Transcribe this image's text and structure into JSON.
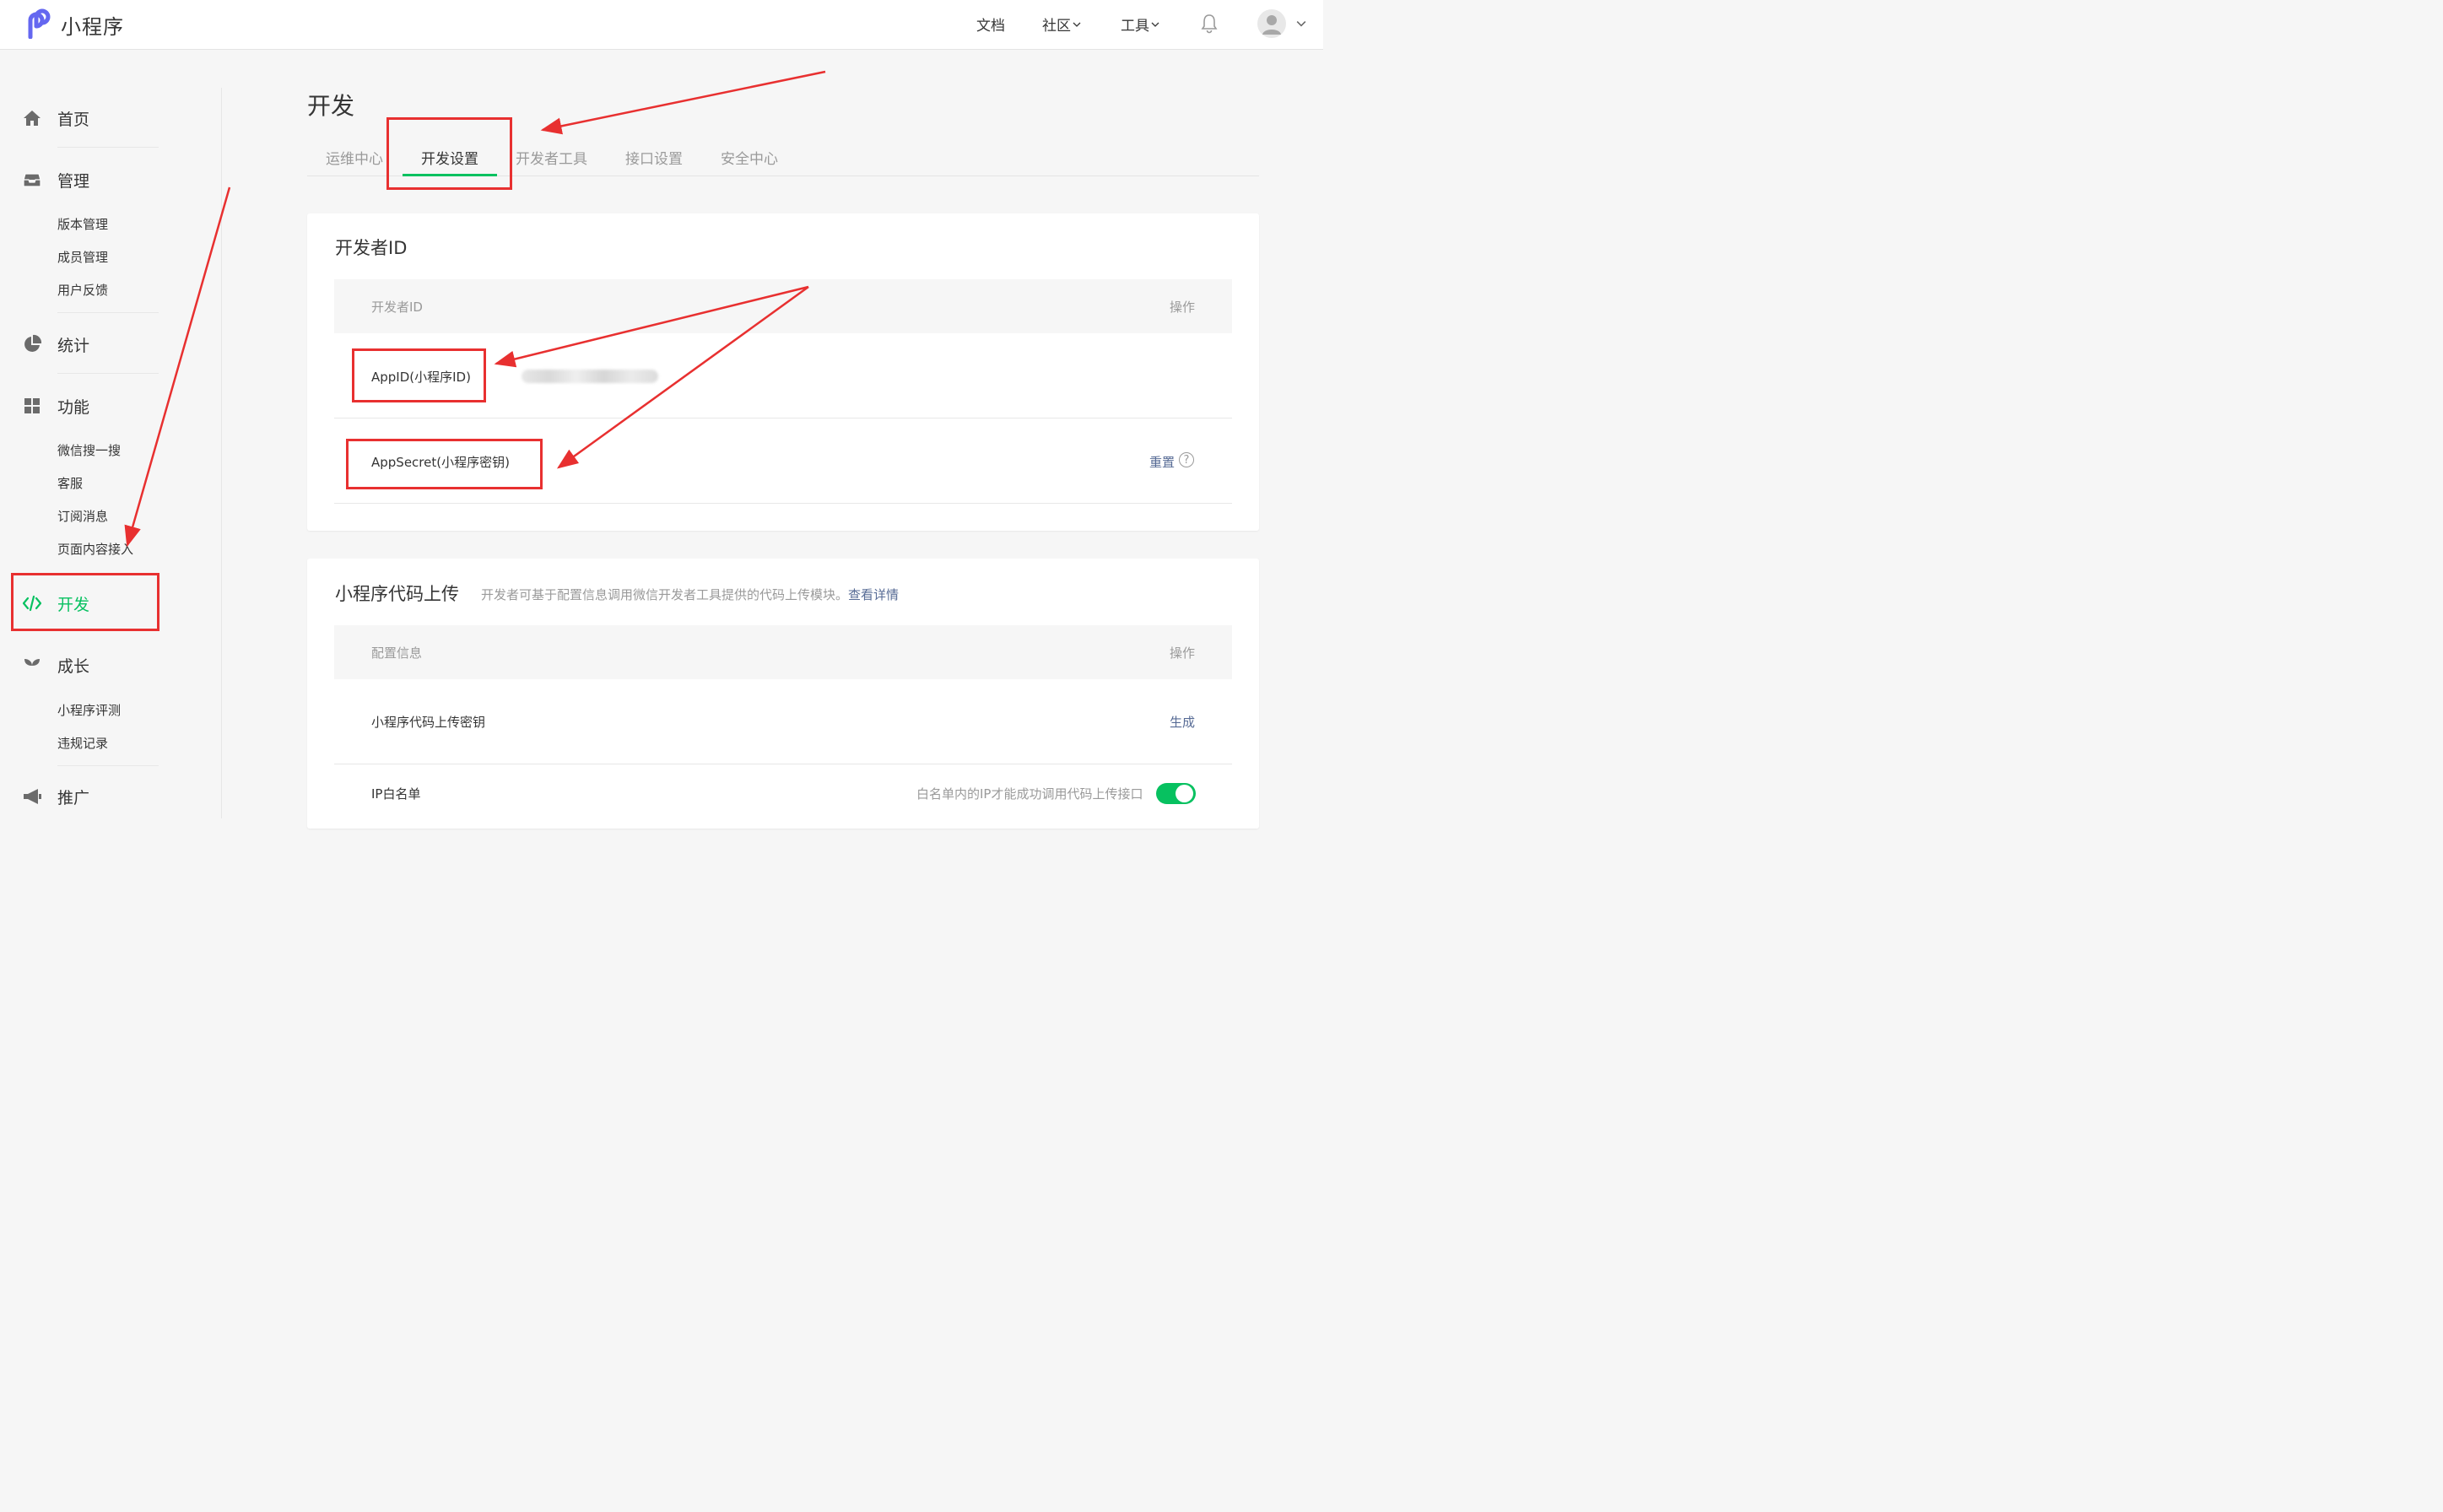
{
  "header": {
    "logo_text": "小程序",
    "links": [
      "文档",
      "社区",
      "工具"
    ]
  },
  "sidebar": {
    "home": "首页",
    "manage": "管理",
    "manage_items": [
      "版本管理",
      "成员管理",
      "用户反馈"
    ],
    "stats": "统计",
    "features": "功能",
    "feature_items": [
      "微信搜一搜",
      "客服",
      "订阅消息",
      "页面内容接入"
    ],
    "develop": "开发",
    "growth": "成长",
    "growth_items": [
      "小程序评测",
      "违规记录"
    ],
    "promote": "推广"
  },
  "main": {
    "title": "开发",
    "tabs": [
      "运维中心",
      "开发设置",
      "开发者工具",
      "接口设置",
      "安全中心"
    ],
    "active_tab": "开发设置"
  },
  "dev_id_card": {
    "title": "开发者ID",
    "col_id": "开发者ID",
    "col_action": "操作",
    "appid_label": "AppID(小程序ID)",
    "secret_label": "AppSecret(小程序密钥)",
    "reset_link": "重置",
    "help_glyph": "?"
  },
  "upload_card": {
    "title": "小程序代码上传",
    "desc": "开发者可基于配置信息调用微信开发者工具提供的代码上传模块。",
    "detail_link": "查看详情",
    "col_config": "配置信息",
    "col_action": "操作",
    "key_label": "小程序代码上传密钥",
    "generate_link": "生成",
    "ip_label": "IP白名单",
    "ip_hint": "白名单内的IP才能成功调用代码上传接口",
    "ip_whitelist_enabled": true
  },
  "colors": {
    "accent_green": "#07c160",
    "link_blue": "#576b95",
    "annotation_red": "#e83030"
  },
  "icons": [
    "logo-icon",
    "chevron-down-icon",
    "bell-icon",
    "avatar-icon",
    "home-icon",
    "inbox-icon",
    "pie-chart-icon",
    "grid-icon",
    "code-icon",
    "sprout-icon",
    "megaphone-icon",
    "help-icon"
  ]
}
